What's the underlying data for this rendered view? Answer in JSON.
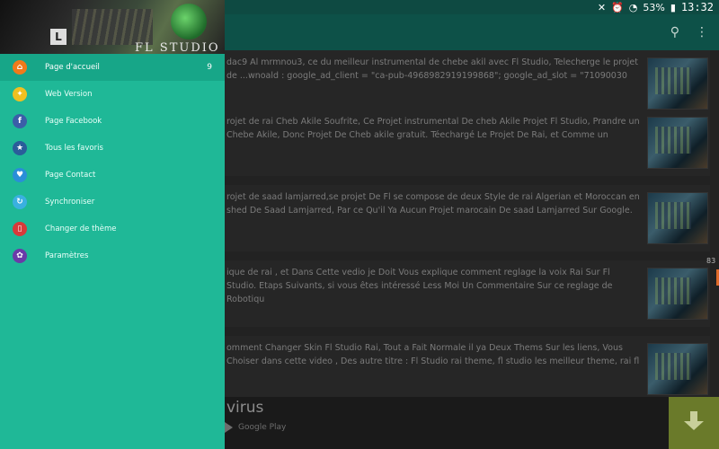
{
  "status_bar": {
    "left_icons": [
      "facebook-icon",
      "image-icon",
      "app-icon"
    ],
    "battery": "53%",
    "time": "13:32"
  },
  "app_bar": {
    "icons": [
      "search-icon",
      "more-icon"
    ]
  },
  "cards": [
    {
      "text": "dac9 Al mrmnou3, ce du meilleur instrumental de chebe akil avec Fl Studio, Telecherge le projet de ...wnoald : google_ad_client = \"ca-pub-4968982919199868\"; google_ad_slot = \"71090030"
    },
    {
      "text": "rojet de rai Cheb Akile Soufrite, Ce Projet instrumental De cheb Akile  Projet Fl Studio, Prandre un Chebe Akile, Donc Projet De Cheb akile gratuit. Téechargé Le Projet De Rai, et Comme un"
    },
    {
      "text": "rojet de saad lamjarred,se projet De Fl se compose de deux  Style de rai  Algerian et Moroccan en shed De Saad Lamjarred, Par ce Qu'il Ya Aucun Projet marocain De saad Lamjarred Sur Google."
    },
    {
      "text": "ique de rai , et Dans Cette vedio je Doit Vous explique comment reglage la voix Rai Sur Fl Studio. Etaps Suivants, si vous êtes intéressé Less Moi Un Commentaire Sur ce reglage de Robotiqu"
    },
    {
      "text": "omment Changer Skin Fl Studio Rai, Tout a Fait Normale il ya Deux Thems Sur les liens, Vous Choiser dans cette  video , Des autre titre : Fl Studio rai theme, fl studio les meilleur theme, rai fl"
    }
  ],
  "side_count": "83",
  "ad": {
    "title": "virus",
    "store": "Google Play"
  },
  "drawer": {
    "brand": "FL STUDIO",
    "logo_letter": "L",
    "items": [
      {
        "label": "Page d'accueil",
        "icon": "home-icon",
        "color": "#f07a1a",
        "badge": "9",
        "active": true
      },
      {
        "label": "Web Version",
        "icon": "web-icon",
        "color": "#f0c020"
      },
      {
        "label": "Page Facebook",
        "icon": "facebook-icon",
        "color": "#3b5ea8"
      },
      {
        "label": "Tous les favoris",
        "icon": "star-icon",
        "color": "#2a5d9a"
      },
      {
        "label": "Page Contact",
        "icon": "contact-icon",
        "color": "#2a8ed8"
      },
      {
        "label": "Synchroniser",
        "icon": "sync-icon",
        "color": "#3ab0e0"
      },
      {
        "label": "Changer de thème",
        "icon": "theme-icon",
        "color": "#d83a3a"
      },
      {
        "label": "Paramètres",
        "icon": "settings-icon",
        "color": "#6a3aa8"
      }
    ]
  }
}
